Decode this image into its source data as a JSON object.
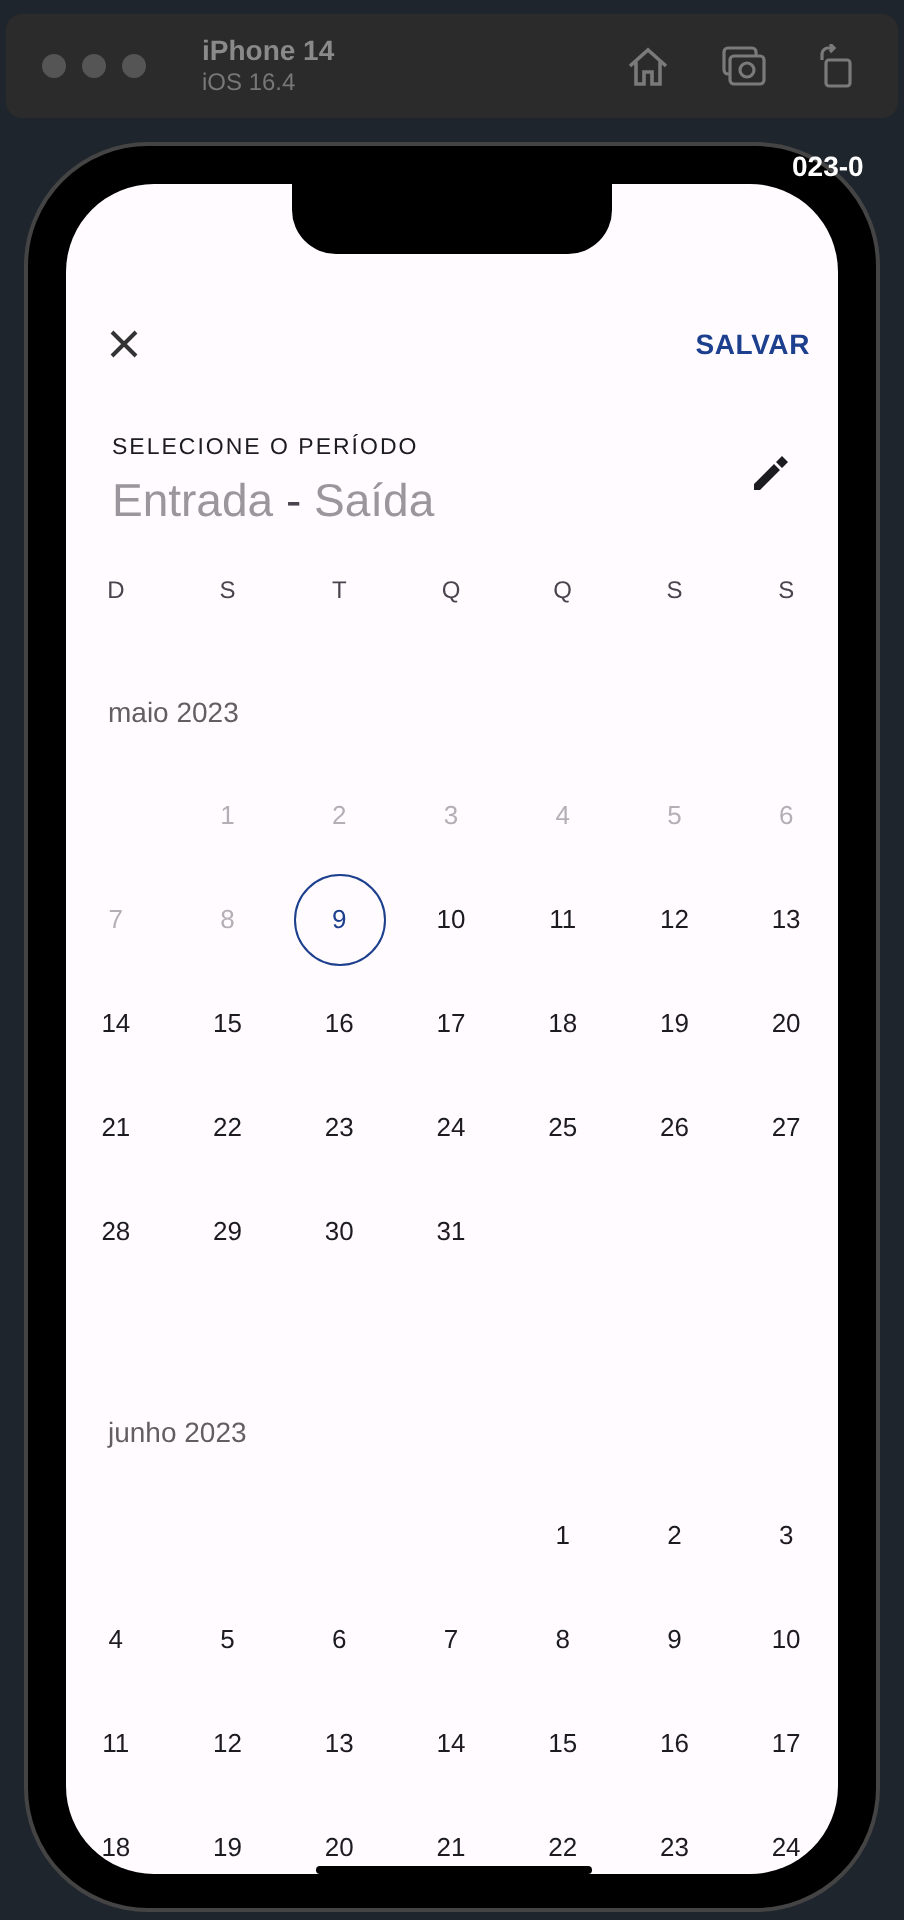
{
  "simulator": {
    "device": "iPhone 14",
    "os": "iOS 16.4"
  },
  "background_text": "023-0",
  "header": {
    "save_label": "SALVAR"
  },
  "subtitle": "SELECIONE O PERÍODO",
  "range": {
    "start": "Entrada",
    "separator": "-",
    "end": "Saída"
  },
  "weekdays": [
    "D",
    "S",
    "T",
    "Q",
    "Q",
    "S",
    "S"
  ],
  "months": [
    {
      "label": "maio 2023",
      "days": [
        {
          "kind": "blank"
        },
        {
          "kind": "day",
          "label": "1",
          "disabled": true,
          "today": false
        },
        {
          "kind": "day",
          "label": "2",
          "disabled": true,
          "today": false
        },
        {
          "kind": "day",
          "label": "3",
          "disabled": true,
          "today": false
        },
        {
          "kind": "day",
          "label": "4",
          "disabled": true,
          "today": false
        },
        {
          "kind": "day",
          "label": "5",
          "disabled": true,
          "today": false
        },
        {
          "kind": "day",
          "label": "6",
          "disabled": true,
          "today": false
        },
        {
          "kind": "day",
          "label": "7",
          "disabled": true,
          "today": false
        },
        {
          "kind": "day",
          "label": "8",
          "disabled": true,
          "today": false
        },
        {
          "kind": "day",
          "label": "9",
          "disabled": false,
          "today": true
        },
        {
          "kind": "day",
          "label": "10",
          "disabled": false,
          "today": false
        },
        {
          "kind": "day",
          "label": "11",
          "disabled": false,
          "today": false
        },
        {
          "kind": "day",
          "label": "12",
          "disabled": false,
          "today": false
        },
        {
          "kind": "day",
          "label": "13",
          "disabled": false,
          "today": false
        },
        {
          "kind": "day",
          "label": "14",
          "disabled": false,
          "today": false
        },
        {
          "kind": "day",
          "label": "15",
          "disabled": false,
          "today": false
        },
        {
          "kind": "day",
          "label": "16",
          "disabled": false,
          "today": false
        },
        {
          "kind": "day",
          "label": "17",
          "disabled": false,
          "today": false
        },
        {
          "kind": "day",
          "label": "18",
          "disabled": false,
          "today": false
        },
        {
          "kind": "day",
          "label": "19",
          "disabled": false,
          "today": false
        },
        {
          "kind": "day",
          "label": "20",
          "disabled": false,
          "today": false
        },
        {
          "kind": "day",
          "label": "21",
          "disabled": false,
          "today": false
        },
        {
          "kind": "day",
          "label": "22",
          "disabled": false,
          "today": false
        },
        {
          "kind": "day",
          "label": "23",
          "disabled": false,
          "today": false
        },
        {
          "kind": "day",
          "label": "24",
          "disabled": false,
          "today": false
        },
        {
          "kind": "day",
          "label": "25",
          "disabled": false,
          "today": false
        },
        {
          "kind": "day",
          "label": "26",
          "disabled": false,
          "today": false
        },
        {
          "kind": "day",
          "label": "27",
          "disabled": false,
          "today": false
        },
        {
          "kind": "day",
          "label": "28",
          "disabled": false,
          "today": false
        },
        {
          "kind": "day",
          "label": "29",
          "disabled": false,
          "today": false
        },
        {
          "kind": "day",
          "label": "30",
          "disabled": false,
          "today": false
        },
        {
          "kind": "day",
          "label": "31",
          "disabled": false,
          "today": false
        }
      ]
    },
    {
      "label": "junho 2023",
      "days": [
        {
          "kind": "blank"
        },
        {
          "kind": "blank"
        },
        {
          "kind": "blank"
        },
        {
          "kind": "blank"
        },
        {
          "kind": "day",
          "label": "1",
          "disabled": false,
          "today": false
        },
        {
          "kind": "day",
          "label": "2",
          "disabled": false,
          "today": false
        },
        {
          "kind": "day",
          "label": "3",
          "disabled": false,
          "today": false
        },
        {
          "kind": "day",
          "label": "4",
          "disabled": false,
          "today": false
        },
        {
          "kind": "day",
          "label": "5",
          "disabled": false,
          "today": false
        },
        {
          "kind": "day",
          "label": "6",
          "disabled": false,
          "today": false
        },
        {
          "kind": "day",
          "label": "7",
          "disabled": false,
          "today": false
        },
        {
          "kind": "day",
          "label": "8",
          "disabled": false,
          "today": false
        },
        {
          "kind": "day",
          "label": "9",
          "disabled": false,
          "today": false
        },
        {
          "kind": "day",
          "label": "10",
          "disabled": false,
          "today": false
        },
        {
          "kind": "day",
          "label": "11",
          "disabled": false,
          "today": false
        },
        {
          "kind": "day",
          "label": "12",
          "disabled": false,
          "today": false
        },
        {
          "kind": "day",
          "label": "13",
          "disabled": false,
          "today": false
        },
        {
          "kind": "day",
          "label": "14",
          "disabled": false,
          "today": false
        },
        {
          "kind": "day",
          "label": "15",
          "disabled": false,
          "today": false
        },
        {
          "kind": "day",
          "label": "16",
          "disabled": false,
          "today": false
        },
        {
          "kind": "day",
          "label": "17",
          "disabled": false,
          "today": false
        },
        {
          "kind": "day",
          "label": "18",
          "disabled": false,
          "today": false
        },
        {
          "kind": "day",
          "label": "19",
          "disabled": false,
          "today": false
        },
        {
          "kind": "day",
          "label": "20",
          "disabled": false,
          "today": false
        },
        {
          "kind": "day",
          "label": "21",
          "disabled": false,
          "today": false
        },
        {
          "kind": "day",
          "label": "22",
          "disabled": false,
          "today": false
        },
        {
          "kind": "day",
          "label": "23",
          "disabled": false,
          "today": false
        },
        {
          "kind": "day",
          "label": "24",
          "disabled": false,
          "today": false
        }
      ]
    }
  ]
}
